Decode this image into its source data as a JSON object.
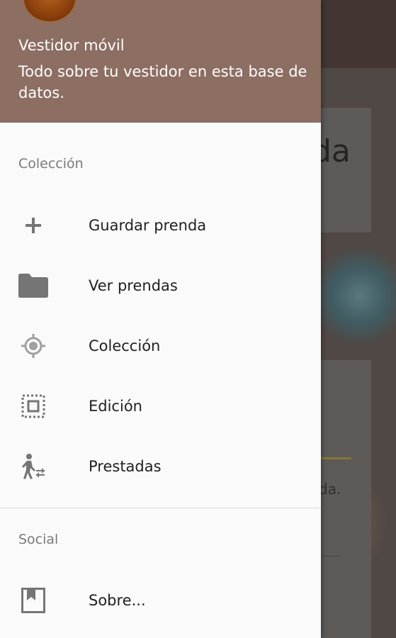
{
  "header": {
    "app_name": "Vestidor móvil",
    "subtitle": "Todo sobre tu vestidor en esta base de datos."
  },
  "sections": {
    "coleccion": {
      "label": "Colección",
      "items": [
        {
          "label": "Guardar prenda",
          "icon": "plus-icon"
        },
        {
          "label": "Ver prendas",
          "icon": "folder-icon"
        },
        {
          "label": "Colección",
          "icon": "gps-target-icon"
        },
        {
          "label": "Edición",
          "icon": "select-frame-icon"
        },
        {
          "label": "Prestadas",
          "icon": "walking-person-icon"
        }
      ]
    },
    "social": {
      "label": "Social",
      "items": [
        {
          "label": "Sobre...",
          "icon": "bookmark-book-icon"
        }
      ]
    }
  },
  "background": {
    "card_text": "da",
    "card_text2": "da."
  },
  "colors": {
    "header_bg": "#8d6e63",
    "drawer_bg": "#fafafa",
    "icon_color": "#757575"
  }
}
